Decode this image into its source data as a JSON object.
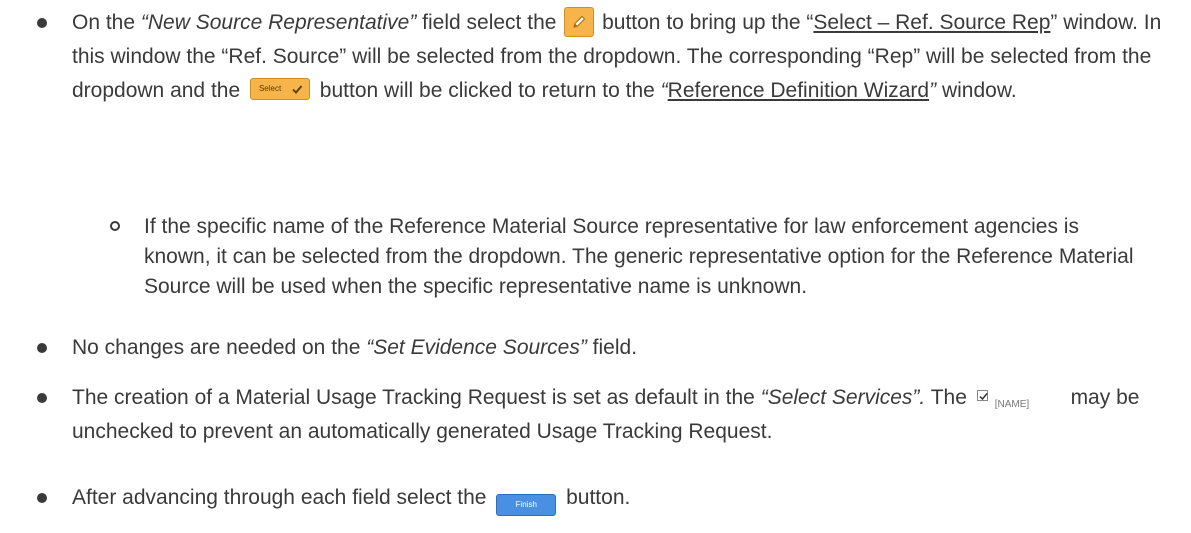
{
  "item1": {
    "t1": "On the ",
    "t2": "“New Source Representative”",
    "t3": " field select the ",
    "t4": " button to bring up the “",
    "t5": "Select – Ref. Source Rep",
    "t6": "” window.  In this window the “Ref. Source” will be selected from the dropdown. The corresponding “Rep” will be selected from the dropdown and the ",
    "t7": " button will be clicked to return to the ",
    "t8": "“",
    "t9": "Reference Definition Wizard",
    "t10": "”",
    "t11": " window.",
    "select_button_label": "Select"
  },
  "sub1": {
    "text": "If the specific name of the Reference Material Source representative for law enforcement agencies is known, it can be selected from the dropdown.  The generic representative option for the Reference Material Source will be used when the specific representative name is unknown."
  },
  "item2": {
    "t1": "No changes are needed on the ",
    "t2": "“Set Evidence Sources”",
    "t3": " field."
  },
  "item3": {
    "t1": "The creation of a Material Usage Tracking Request is set as default in the ",
    "t2": "“Select Services”.",
    "t3": " The ",
    "t4": " may be unchecked to prevent an automatically generated Usage Tracking Request.",
    "checkbox_label": "[NAME]"
  },
  "item4": {
    "t1": "After advancing through each field select the ",
    "t2": " button.",
    "finish_button_label": "Finish"
  }
}
